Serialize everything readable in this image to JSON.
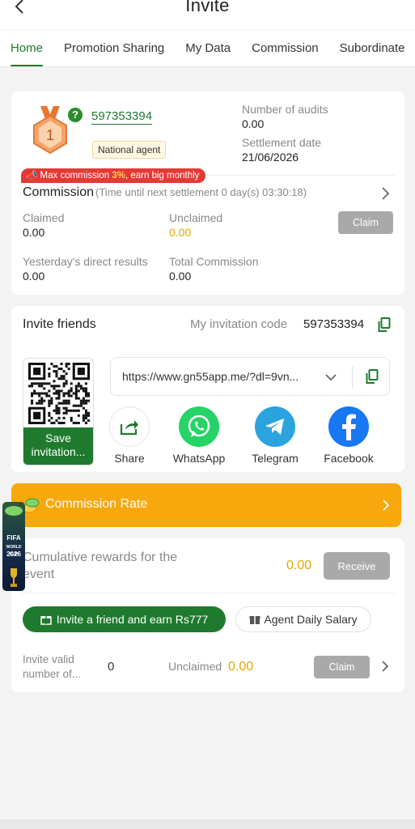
{
  "header": {
    "title": "Invite"
  },
  "tabs": [
    {
      "label": "Home",
      "active": true
    },
    {
      "label": "Promotion Sharing"
    },
    {
      "label": "My Data"
    },
    {
      "label": "Commission"
    },
    {
      "label": "Subordinate"
    }
  ],
  "agent": {
    "medal_number": "1",
    "id": "597353394",
    "level": "National agent",
    "audits_label": "Number of audits",
    "audits_value": "0.00",
    "settlement_label": "Settlement date",
    "settlement_value": "21/06/2026"
  },
  "promo": {
    "prefix": "Max commission ",
    "highlight": "3%",
    "suffix": ", earn big monthly"
  },
  "commission": {
    "title": "Commission",
    "note": "(Time until next settlement  0 day(s) 03:30:18)",
    "claimed_label": "Claimed",
    "claimed_value": "0.00",
    "unclaimed_label": "Unclaimed",
    "unclaimed_value": "0.00",
    "claim_label": "Claim",
    "yesterday_label": "Yesterday's direct results",
    "yesterday_value": "0.00",
    "total_label": "Total Commission",
    "total_value": "0.00"
  },
  "invite": {
    "title": "Invite friends",
    "code_label": "My invitation code",
    "code_value": "597353394",
    "save_label": "Save invitation...",
    "url": "https://www.gn55app.me/?dl=9vn...",
    "share": [
      {
        "label": "Share",
        "icon": "share-icon",
        "color": "#ffffff"
      },
      {
        "label": "WhatsApp",
        "icon": "whatsapp-icon",
        "color": "#25d366"
      },
      {
        "label": "Telegram",
        "icon": "telegram-icon",
        "color": "#2aa3df"
      },
      {
        "label": "Facebook",
        "icon": "facebook-icon",
        "color": "#1877f2"
      }
    ]
  },
  "rate": {
    "label": "Commission Rate"
  },
  "event": {
    "title": "Cumulative rewards for the event",
    "value": "0.00",
    "receive_label": "Receive",
    "invite_earn_label": "Invite a friend and earn Rs777",
    "salary_label": "Agent Daily Salary",
    "valid_label": "Invite valid number of...",
    "valid_value": "0",
    "unclaimed_label": "Unclaimed",
    "unclaimed_value": "0.00",
    "claim_label": "Claim"
  },
  "widget": {
    "line1": "FIFA",
    "line2": "WORLD CUP",
    "line3": "2026"
  },
  "colors": {
    "brand_green": "#1f7a2d",
    "gold": "#e0a800",
    "orange": "#f7a80d",
    "promo_red": "#e53935",
    "button_gray": "#a9a9a9"
  }
}
